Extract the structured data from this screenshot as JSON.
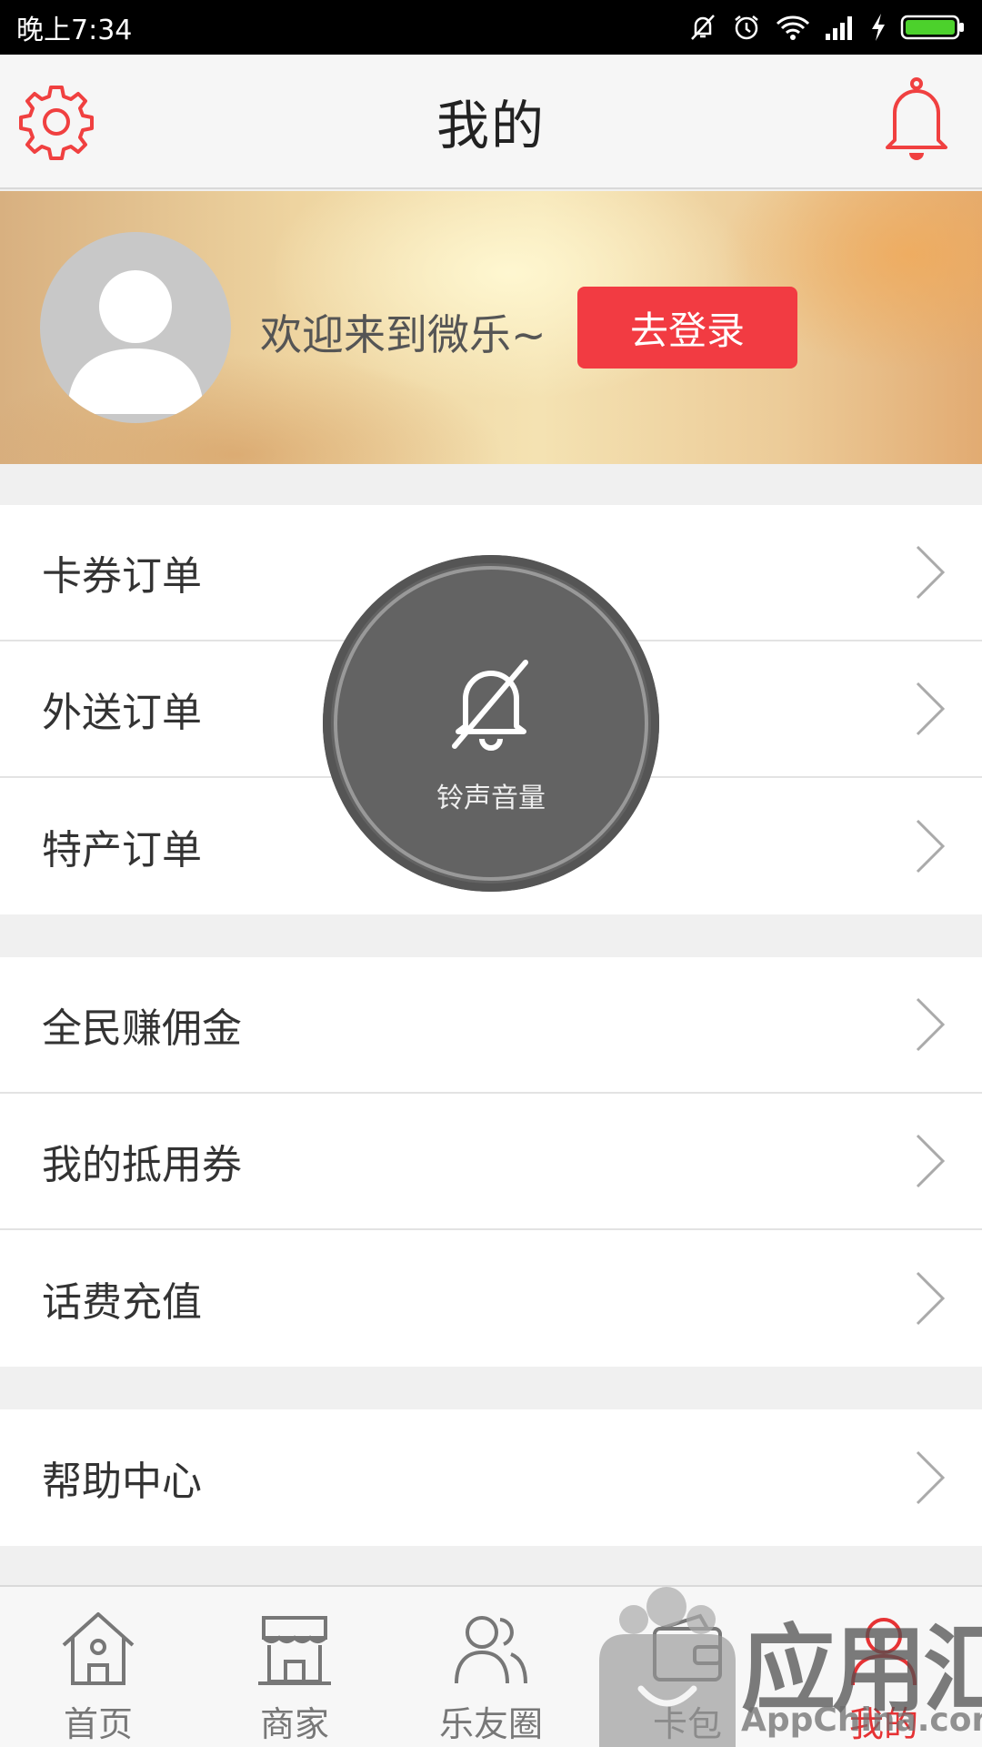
{
  "status_bar": {
    "time": "晚上7:34"
  },
  "header": {
    "title": "我的",
    "settings_icon": "gear-icon",
    "notification_icon": "bell-icon",
    "accent_color": "#f03c3c"
  },
  "profile": {
    "welcome_text": "欢迎来到微乐~",
    "login_label": "去登录",
    "login_color": "#f23b42"
  },
  "menu_groups": [
    {
      "items": [
        {
          "label": "卡券订单"
        },
        {
          "label": "外送订单"
        },
        {
          "label": "特产订单"
        }
      ]
    },
    {
      "items": [
        {
          "label": "全民赚佣金"
        },
        {
          "label": "我的抵用券"
        },
        {
          "label": "话费充值"
        }
      ]
    },
    {
      "items": [
        {
          "label": "帮助中心"
        }
      ]
    }
  ],
  "volume_overlay": {
    "label": "铃声音量",
    "icon": "bell-muted-icon"
  },
  "tab_bar": {
    "active_color": "#e63234",
    "tabs": [
      {
        "label": "首页",
        "icon": "home-icon",
        "active": false
      },
      {
        "label": "商家",
        "icon": "store-icon",
        "active": false
      },
      {
        "label": "乐友圈",
        "icon": "friends-icon",
        "active": false
      },
      {
        "label": "卡包",
        "icon": "wallet-icon",
        "active": false
      },
      {
        "label": "我的",
        "icon": "profile-icon",
        "active": true
      }
    ]
  },
  "watermark": {
    "title": "应用汇",
    "subtitle": "AppChina.com"
  }
}
